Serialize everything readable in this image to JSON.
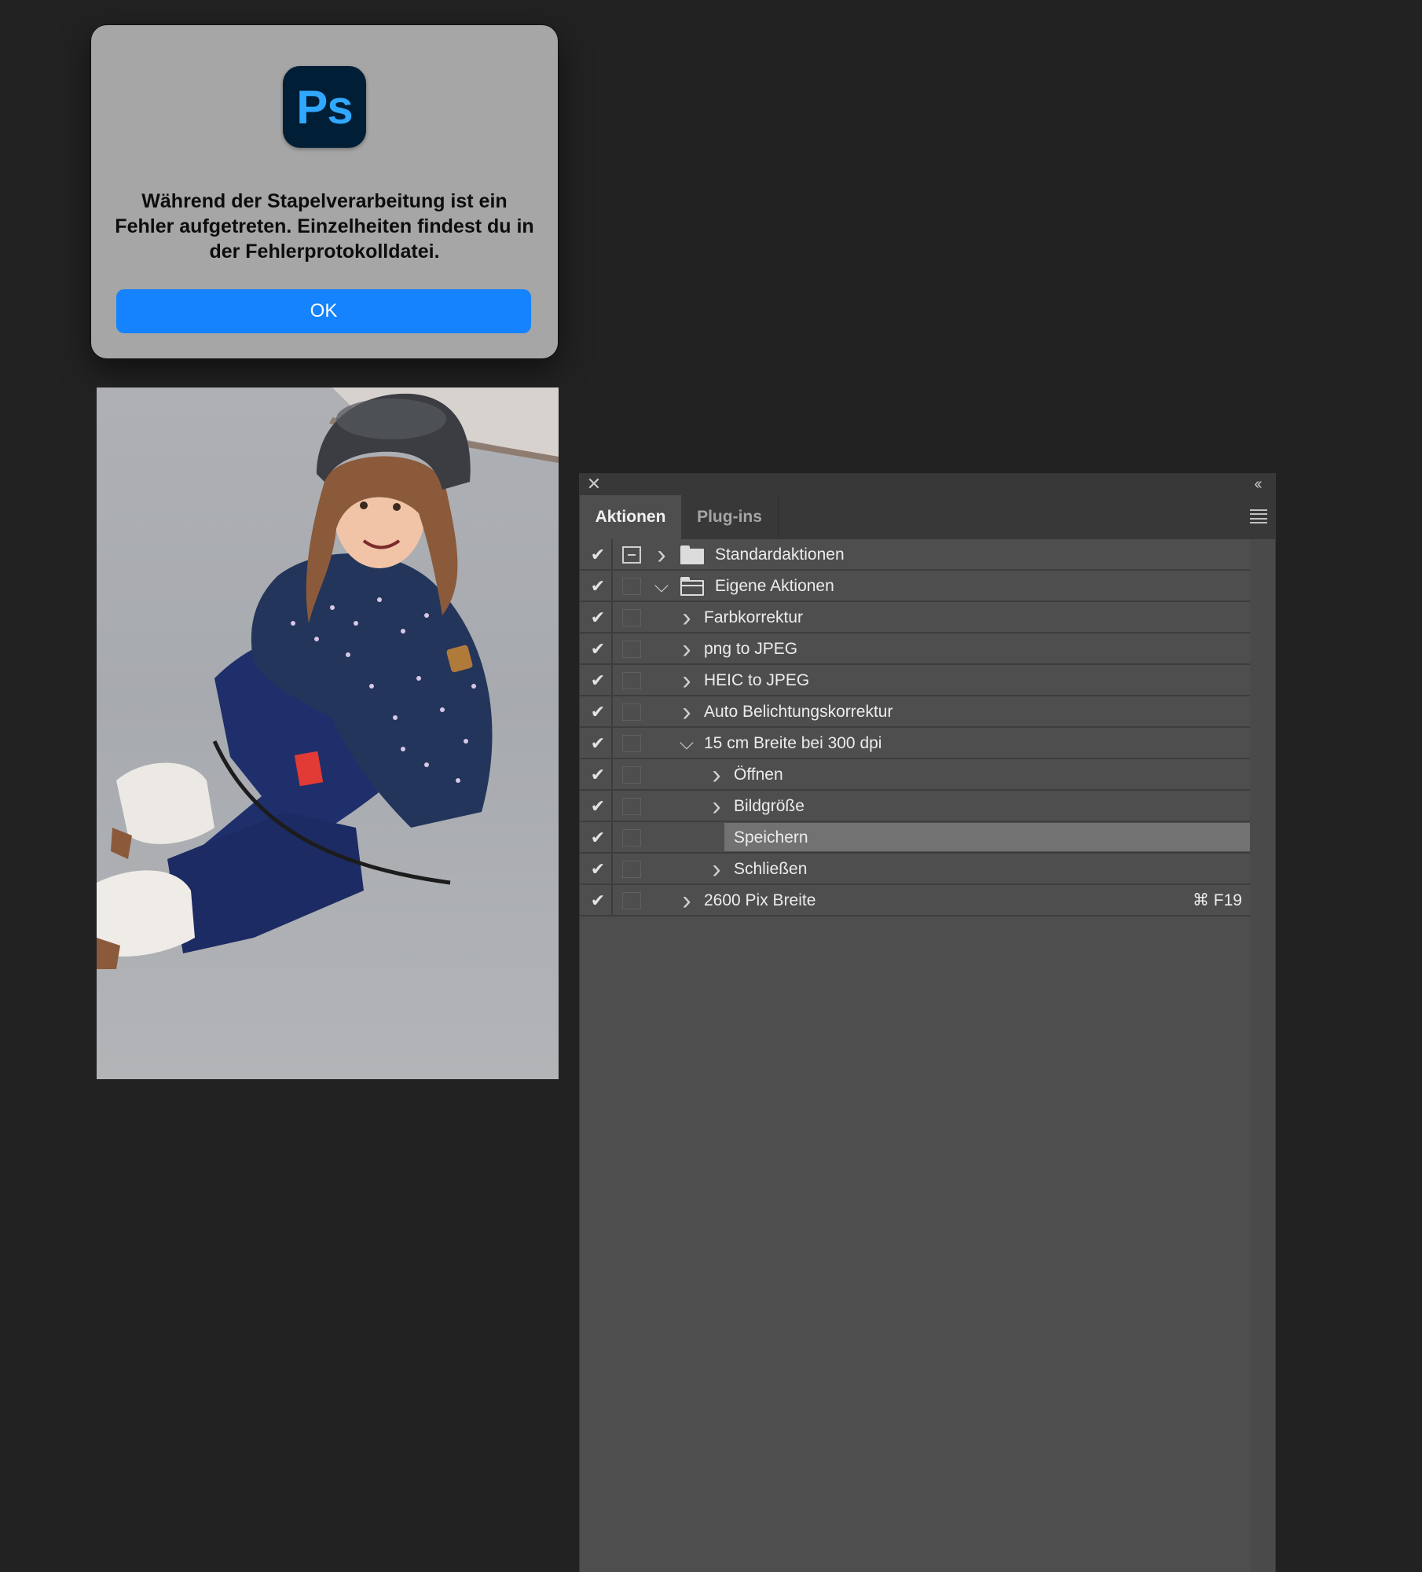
{
  "alert": {
    "app_icon_label": "Ps",
    "message": "Während der Stapelverarbeitung ist ein Fehler aufgetreten. Einzelheiten findest du in der Fehlerprotokolldatei.",
    "ok_label": "OK"
  },
  "panel": {
    "close_glyph": "✕",
    "collapse_glyph": "‹‹",
    "tabs": [
      "Aktionen",
      "Plug-ins"
    ],
    "rows": [
      {
        "label": "Standardaktionen",
        "level": 0,
        "type": "set",
        "expanded": false,
        "checked": true,
        "dialog": true
      },
      {
        "label": "Eigene Aktionen",
        "level": 0,
        "type": "set",
        "expanded": true,
        "checked": true,
        "dialog": false
      },
      {
        "label": "Farbkorrektur",
        "level": 1,
        "type": "action",
        "expanded": false,
        "checked": true
      },
      {
        "label": "png to JPEG",
        "level": 1,
        "type": "action",
        "expanded": false,
        "checked": true
      },
      {
        "label": "HEIC to JPEG",
        "level": 1,
        "type": "action",
        "expanded": false,
        "checked": true
      },
      {
        "label": "Auto Belichtungskorrektur",
        "level": 1,
        "type": "action",
        "expanded": false,
        "checked": true
      },
      {
        "label": "15 cm Breite bei 300 dpi",
        "level": 1,
        "type": "action",
        "expanded": true,
        "checked": true
      },
      {
        "label": "Öffnen",
        "level": 2,
        "type": "step",
        "expanded": false,
        "checked": true
      },
      {
        "label": "Bildgröße",
        "level": 2,
        "type": "step",
        "expanded": false,
        "checked": true
      },
      {
        "label": "Speichern",
        "level": 2,
        "type": "step",
        "selected": true,
        "checked": true
      },
      {
        "label": "Schließen",
        "level": 2,
        "type": "step",
        "expanded": false,
        "checked": true
      },
      {
        "label": "2600 Pix Breite",
        "level": 1,
        "type": "action",
        "expanded": false,
        "checked": true,
        "shortcut": "⌘ F19"
      }
    ]
  },
  "icons": {
    "check": "check-icon",
    "chevron_right": "chevron-right-icon",
    "chevron_down": "chevron-down-icon",
    "folder": "folder-icon"
  },
  "colors": {
    "ok_button": "#1483fd",
    "ps_icon_bg": "#001e36",
    "ps_icon_text": "#31a8ff",
    "panel_bg": "#4e4e4e",
    "selected_row": "#727272"
  }
}
